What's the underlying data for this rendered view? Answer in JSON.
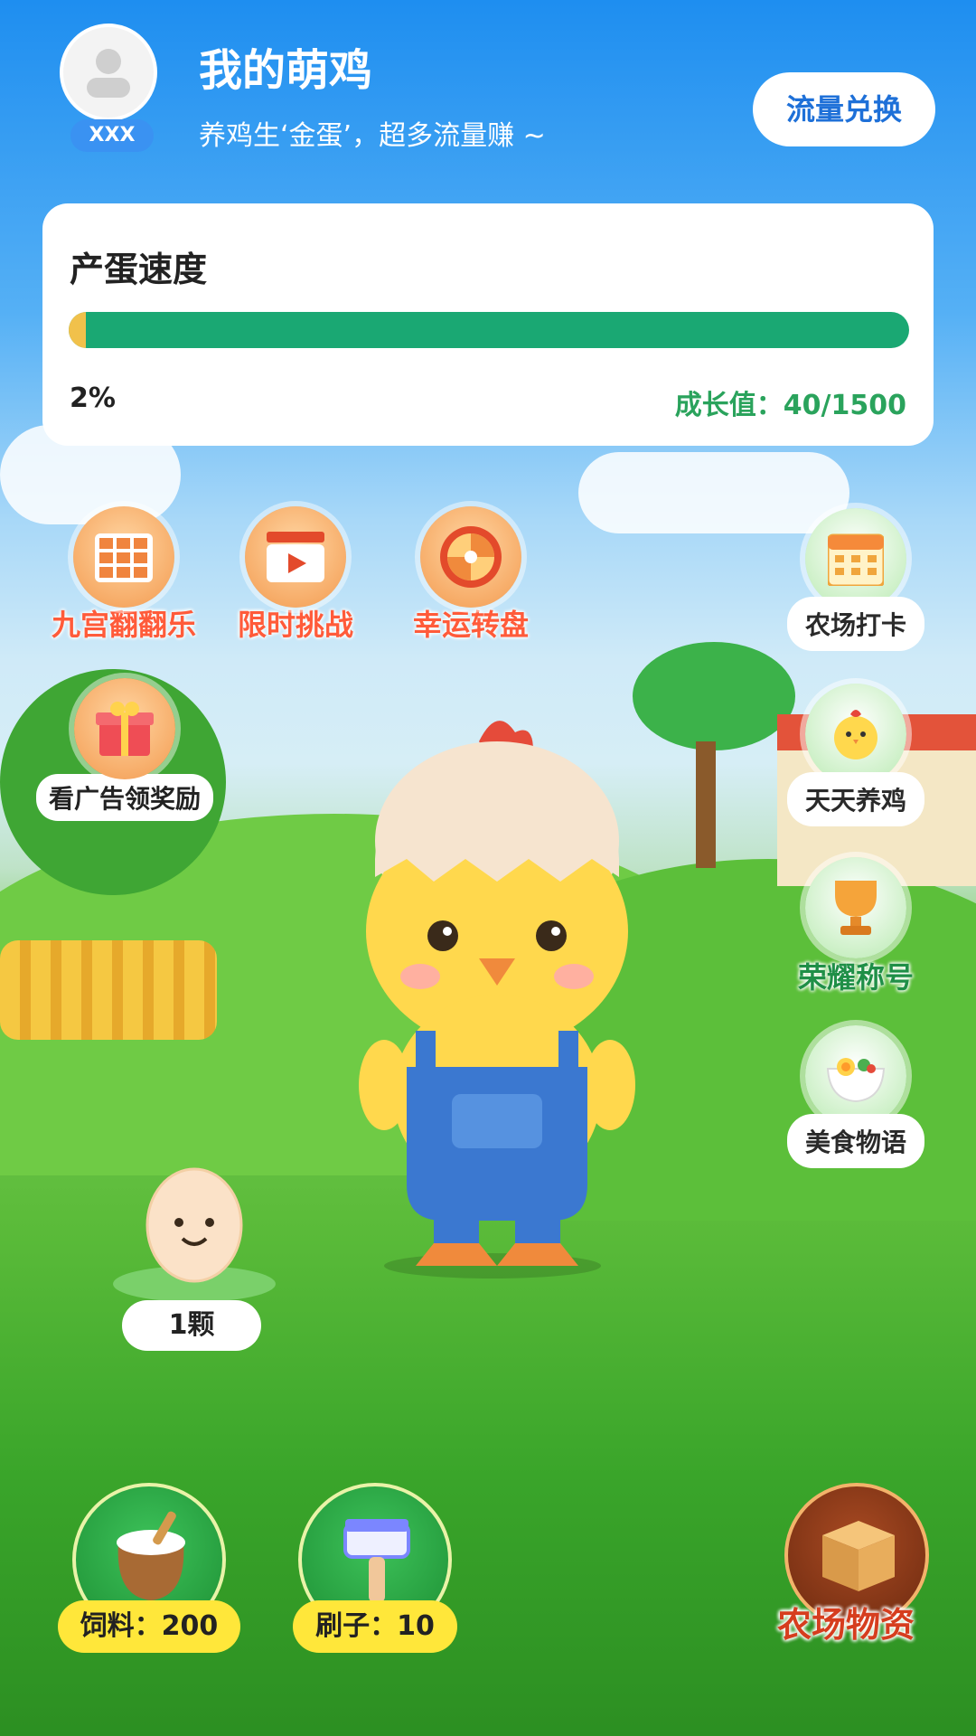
{
  "header": {
    "nickname": "XXX",
    "title": "我的萌鸡",
    "subtitle": "养鸡生‘金蛋’，超多流量赚 ~",
    "exchange_button": "流量兑换"
  },
  "progress_card": {
    "title": "产蛋速度",
    "percent_label": "2%",
    "progress_fraction": 0.02,
    "growth_label": "成长值：40/1500",
    "bar_color": "#1aa873",
    "fill_color": "#f1c14b"
  },
  "top_features": [
    {
      "label": "九宫翻翻乐",
      "icon": "grid-icon"
    },
    {
      "label": "限时挑战",
      "icon": "clapperboard-icon"
    },
    {
      "label": "幸运转盘",
      "icon": "wheel-icon"
    }
  ],
  "left_feature": {
    "label": "看广告领奖励",
    "icon": "gift-box-icon"
  },
  "right_features": [
    {
      "label": "农场打卡",
      "icon": "calendar-icon"
    },
    {
      "label": "天天养鸡",
      "icon": "chick-icon"
    },
    {
      "label": "荣耀称号",
      "icon": "trophy-icon"
    },
    {
      "label": "美食物语",
      "icon": "food-bowl-icon"
    }
  ],
  "egg": {
    "count_label": "1颗"
  },
  "bottom_items": [
    {
      "label": "饲料：200",
      "icon": "feed-sack-icon"
    },
    {
      "label": "刷子：10",
      "icon": "brush-icon"
    }
  ],
  "supplies": {
    "label": "农场物资",
    "icon": "box-icon"
  }
}
